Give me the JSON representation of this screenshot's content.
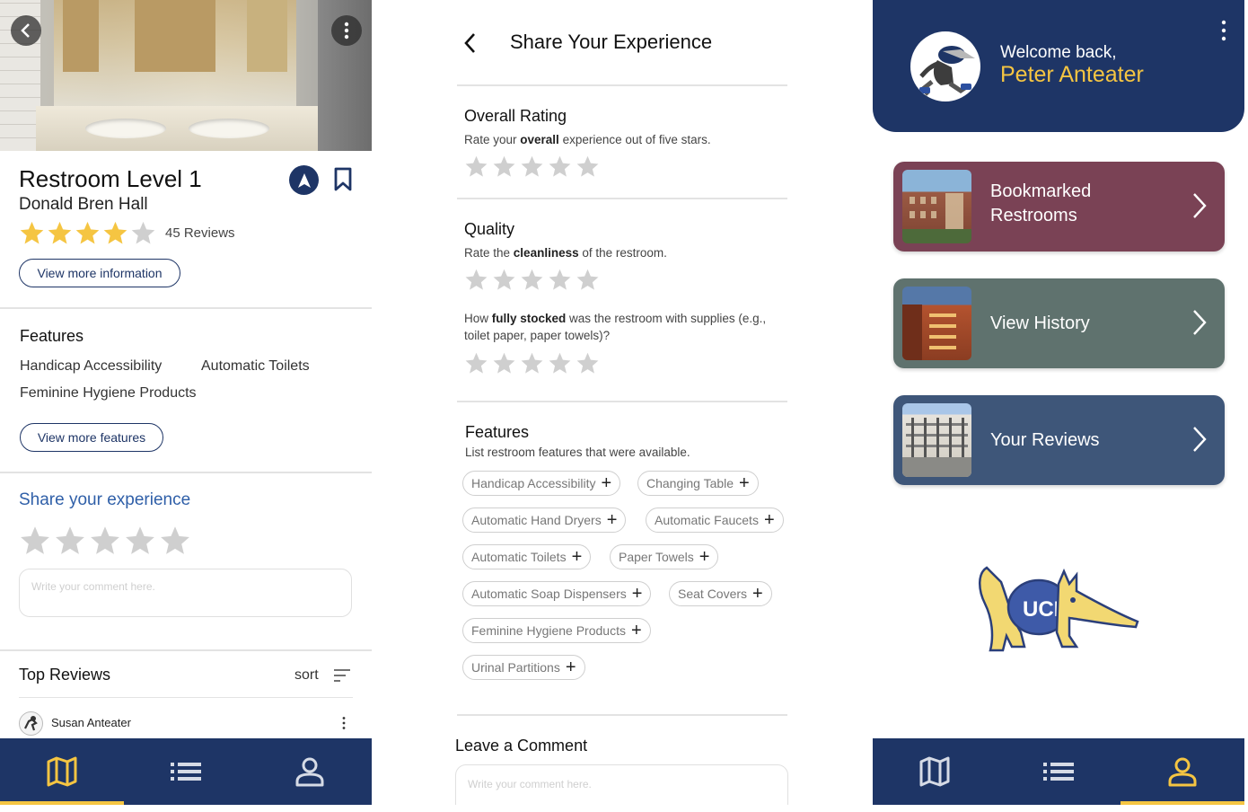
{
  "restroom_detail": {
    "title": "Restroom Level 1",
    "building": "Donald Bren Hall",
    "rating_stars": 4,
    "reviews_count": "45 Reviews",
    "view_more_info": "View more information",
    "features_heading": "Features",
    "features": [
      "Handicap Accessibility",
      "Automatic Toilets",
      "Feminine Hygiene Products"
    ],
    "view_more_features": "View more features",
    "share_heading": "Share your experience",
    "comment_placeholder": "Write your comment here.",
    "top_reviews_heading": "Top Reviews",
    "sort_label": "sort",
    "first_reviewer": "Susan Anteater"
  },
  "share_form": {
    "title": "Share Your Experience",
    "overall_heading": "Overall Rating",
    "overall_pre": "Rate your ",
    "overall_bold": "overall",
    "overall_post": " experience out of five stars.",
    "quality_heading": "Quality",
    "quality_pre": "Rate the ",
    "quality_bold": "cleanliness",
    "quality_post": " of the restroom.",
    "stock_pre": "How ",
    "stock_bold": "fully stocked",
    "stock_post": " was the restroom with supplies (e.g., toilet paper, paper towels)?",
    "features_heading": "Features",
    "features_sub": "List restroom features that were available.",
    "feature_chips": [
      "Handicap Accessibility",
      "Changing Table",
      "Automatic Hand Dryers",
      "Automatic Faucets",
      "Automatic Toilets",
      "Paper Towels",
      "Automatic Soap Dispensers",
      "Seat Covers",
      "Feminine Hygiene Products",
      "Urinal Partitions"
    ],
    "comment_heading": "Leave a Comment",
    "comment_placeholder": "Write your comment here."
  },
  "profile": {
    "welcome": "Welcome back,",
    "user_name": "Peter Anteater",
    "cards": [
      {
        "label_line1": "Bookmarked",
        "label_line2": "Restrooms",
        "color": "#7a4255"
      },
      {
        "label_line1": "View History",
        "label_line2": "",
        "color": "#5f726e"
      },
      {
        "label_line1": "Your Reviews",
        "label_line2": "",
        "color": "#3e5679"
      }
    ]
  },
  "colors": {
    "navy": "#1e3566",
    "gold": "#f5c542",
    "star_gold": "#f5c542",
    "star_gray": "#cfcfcf",
    "link_blue": "#2f5fa8"
  }
}
